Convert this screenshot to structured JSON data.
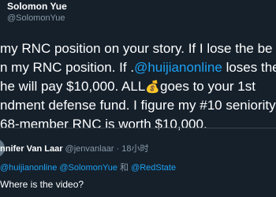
{
  "tweet": {
    "author_name": "Solomon Yue",
    "author_handle": "@SolomonYue",
    "line1": "my RNC position on your story. If I lose the be",
    "line2_a": "n my RNC position. If .",
    "line2_mention": "@huijianonline",
    "line2_b": " loses the",
    "line3_a": "he will pay $10,000. ALL",
    "line3_emoji": "💰",
    "line3_b": "goes to your 1st",
    "line4": "ndment defense fund. I figure my #10 seniority",
    "line5": "68-member RNC is worth $10,000."
  },
  "reply": {
    "name": "nnifer Van Laar",
    "handle": "@jenvanlaar",
    "separator": " · ",
    "time": "18小时",
    "to_handle_1": "@huijianonline",
    "to_handle_2": "@SolomonYue",
    "to_and": " 和 ",
    "to_handle_3": "@RedState",
    "text": "Where is the video?"
  },
  "colors": {
    "background": "#15202b",
    "link": "#1da1f2",
    "secondary_text": "#8899a6",
    "divider": "#38444d"
  }
}
